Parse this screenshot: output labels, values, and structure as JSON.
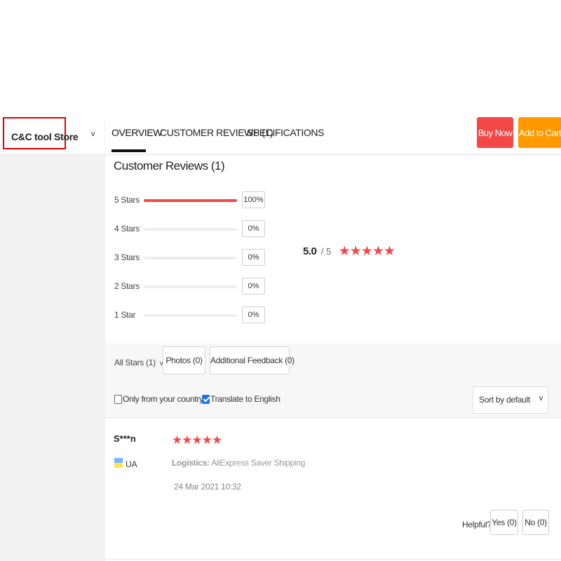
{
  "store": {
    "name": "C&C tool Store",
    "chevron": "v"
  },
  "nav": {
    "tabs": [
      {
        "label": "OVERVIEW"
      },
      {
        "label": "CUSTOMER REVIEWS (1)"
      },
      {
        "label": "SPECIFICATIONS"
      }
    ],
    "buy_now": "Buy Now",
    "add_to_cart": "Add to Cart"
  },
  "reviews": {
    "title": "Customer Reviews (1)",
    "breakdown": [
      {
        "label": "5 Stars",
        "percent_text": "100%",
        "fraction": 1.0
      },
      {
        "label": "4 Stars",
        "percent_text": "0%",
        "fraction": 0
      },
      {
        "label": "3 Stars",
        "percent_text": "0%",
        "fraction": 0
      },
      {
        "label": "2 Stars",
        "percent_text": "0%",
        "fraction": 0
      },
      {
        "label": "1 Star",
        "percent_text": "0%",
        "fraction": 0
      }
    ],
    "overall": {
      "score": "5.0",
      "out_of": "/ 5",
      "stars": "★★★★★"
    }
  },
  "filters": {
    "all_stars": "All Stars (1)",
    "all_stars_chevron": "v",
    "photos": "Photos (0)",
    "additional_feedback": "Additional Feedback (0)",
    "only_country": "Only from your country",
    "only_country_checked": false,
    "translate": "Translate to English",
    "translate_checked": true,
    "sort": "Sort by default",
    "sort_chevron": "v"
  },
  "review_items": [
    {
      "user": "S***n",
      "country": "UA",
      "stars": "★★★★★",
      "logistics_label": "Logistics:",
      "logistics_value": "AliExpress Saver Shipping",
      "date": "24 Mar 2021 10:32",
      "helpful_label": "Helpful?",
      "yes": "Yes (0)",
      "no": "No (0)"
    }
  ],
  "colors": {
    "accent_red": "#f44848",
    "accent_orange": "#ff9900",
    "highlight_box": "#e00000",
    "checkbox_blue": "#1a73e8"
  }
}
